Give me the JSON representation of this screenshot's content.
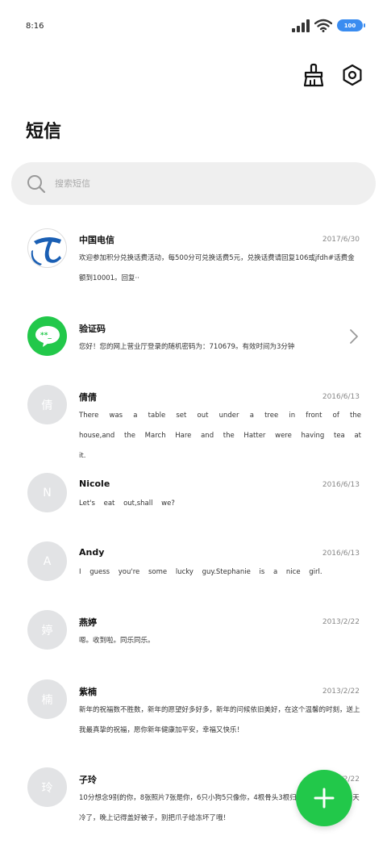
{
  "status_bar": {
    "time": "8:16",
    "battery": "100"
  },
  "header": {
    "title": "短信"
  },
  "search": {
    "placeholder": "搜索短信"
  },
  "messages": [
    {
      "name": "中国电信",
      "date": "2017/6/30",
      "body": "欢迎参加积分兑换话费活动，每500分可兑换话费5元，兑换话费请回复106或jfdh#话费金额到10001。回复··",
      "avatar": "china-telecom-logo"
    },
    {
      "name": "验证码",
      "date": "",
      "body": "您好！您的网上营业厅登录的随机密码为：710679。有效时间为3分钟",
      "avatar": "chat-bubble-logo"
    },
    {
      "name": "倩倩",
      "date": "2016/6/13",
      "body": "There was a table set out under a tree in front of the house,and the March Hare and the Hatter were having tea at it.",
      "avatar": "倩"
    },
    {
      "name": "Nicole",
      "date": "2016/6/13",
      "body": "Let's eat out,shall we?",
      "avatar": "N"
    },
    {
      "name": "Andy",
      "date": "2016/6/13",
      "body": "I guess you're some lucky guy.Stephanie is a nice girl.",
      "avatar": "A"
    },
    {
      "name": "燕婷",
      "date": "2013/2/22",
      "body": "嗯。收到啦。同乐同乐。",
      "avatar": "婷"
    },
    {
      "name": "紫楠",
      "date": "2013/2/22",
      "body": "新年的祝福数不胜数，新年的愿望好多好多，新年的问候依旧美好，在这个温馨的时刻，送上我最真挚的祝福，愿你新年健康加平安，幸福又快乐！",
      "avatar": "楠"
    },
    {
      "name": "子玲",
      "date": "2013/2/22",
      "body": "10分想念9别的你，8张照片7张是你，6只小狗5只像你，4根骨头3根归你，2013年1月份天冷了，晚上记得盖好被子，别把爪子给冻坏了哦！",
      "avatar": "玲"
    }
  ],
  "colors": {
    "accent": "#22c84a",
    "telecom_blue": "#1a5fb4",
    "avatar_gray": "#e2e3e5"
  },
  "icons": {
    "clean": "broom-icon",
    "settings": "hex-nut-settings-icon",
    "compose": "plus-icon"
  }
}
